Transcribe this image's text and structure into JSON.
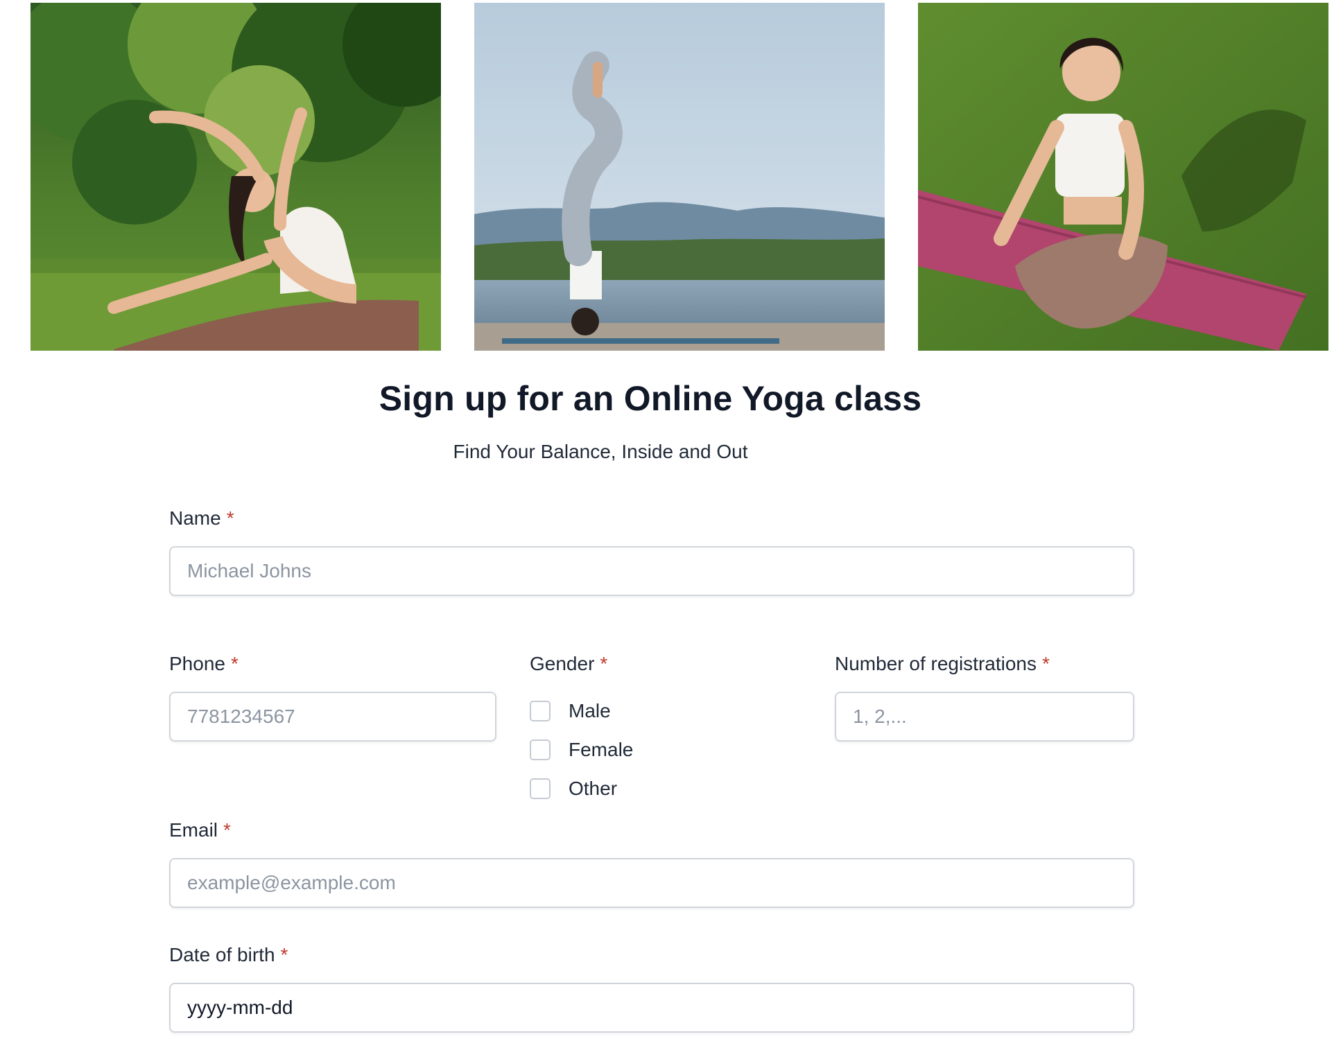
{
  "hero": {
    "photos": [
      {
        "name": "yoga-side-stretch-photo"
      },
      {
        "name": "yoga-headstand-lake-photo"
      },
      {
        "name": "yoga-lotus-meditation-photo"
      }
    ]
  },
  "header": {
    "title": "Sign up for an Online Yoga class",
    "subtitle": "Find Your Balance, Inside and Out"
  },
  "form": {
    "required_marker": "*",
    "name": {
      "label": "Name",
      "placeholder": "Michael Johns"
    },
    "phone": {
      "label": "Phone",
      "placeholder": "7781234567"
    },
    "gender": {
      "label": "Gender",
      "options": [
        {
          "label": "Male",
          "checked": false
        },
        {
          "label": "Female",
          "checked": false
        },
        {
          "label": "Other",
          "checked": false
        }
      ]
    },
    "registrations": {
      "label": "Number of registrations",
      "placeholder": "1, 2,..."
    },
    "email": {
      "label": "Email",
      "placeholder": "example@example.com"
    },
    "dob": {
      "label": "Date of birth",
      "placeholder": "yyyy-mm-dd"
    }
  },
  "colors": {
    "required": "#c0392b",
    "border": "#d1d5db",
    "placeholder": "#8b95a1",
    "text": "#111827"
  }
}
